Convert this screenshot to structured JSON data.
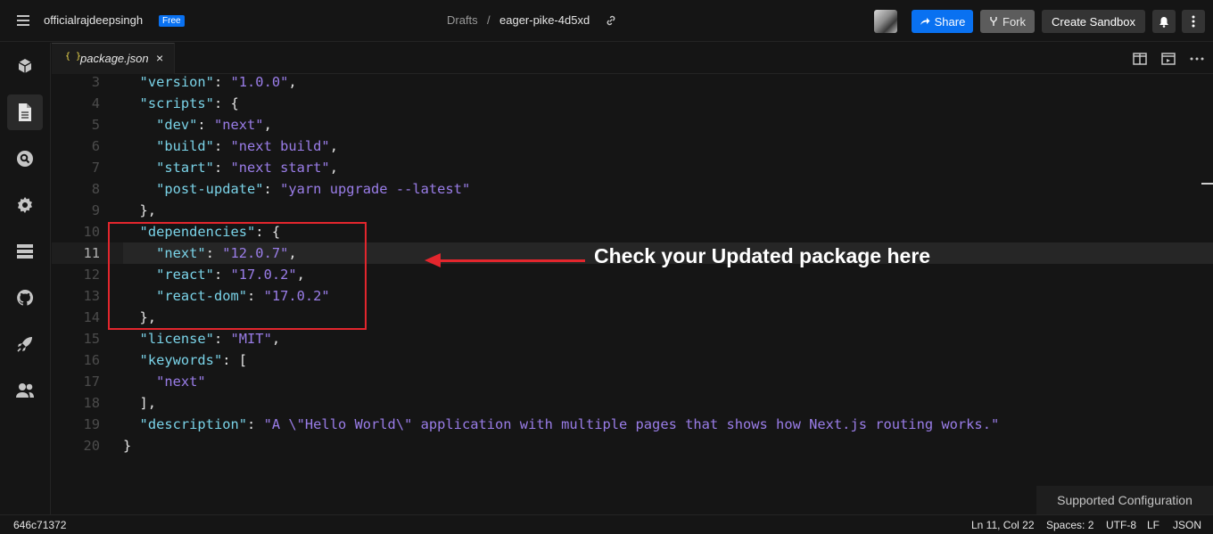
{
  "header": {
    "username": "officialrajdeepsingh",
    "plan_badge": "Free",
    "breadcrumb_drafts": "Drafts",
    "breadcrumb_sep": "/",
    "sandbox_name": "eager-pike-4d5xd",
    "share_label": "Share",
    "fork_label": "Fork",
    "create_label": "Create Sandbox"
  },
  "tab": {
    "icon_text": "{ }",
    "filename": "package.json",
    "close": "×"
  },
  "editor": {
    "lines": [
      {
        "n": "3"
      },
      {
        "n": "4"
      },
      {
        "n": "5"
      },
      {
        "n": "6"
      },
      {
        "n": "7"
      },
      {
        "n": "8"
      },
      {
        "n": "9"
      },
      {
        "n": "10"
      },
      {
        "n": "11"
      },
      {
        "n": "12"
      },
      {
        "n": "13"
      },
      {
        "n": "14"
      },
      {
        "n": "15"
      },
      {
        "n": "16"
      },
      {
        "n": "17"
      },
      {
        "n": "18"
      },
      {
        "n": "19"
      },
      {
        "n": "20"
      }
    ],
    "tokens": {
      "version_key": "\"version\"",
      "version_val": "\"1.0.0\"",
      "scripts_key": "\"scripts\"",
      "dev_key": "\"dev\"",
      "dev_val": "\"next\"",
      "build_key": "\"build\"",
      "build_val": "\"next build\"",
      "start_key": "\"start\"",
      "start_val": "\"next start\"",
      "post_key": "\"post-update\"",
      "post_val": "\"yarn upgrade --latest\"",
      "deps_key": "\"dependencies\"",
      "next_key": "\"next\"",
      "next_val": "\"12.0.7\"",
      "react_key": "\"react\"",
      "react_val": "\"17.0.2\"",
      "reactdom_key": "\"react-dom\"",
      "reactdom_val": "\"17.0.2\"",
      "license_key": "\"license\"",
      "license_val": "\"MIT\"",
      "keywords_key": "\"keywords\"",
      "kw_val": "\"next\"",
      "desc_key": "\"description\"",
      "desc_val": "\"A \\\"Hello World\\\" application with multiple pages that shows how Next.js routing works.\""
    }
  },
  "annotation": {
    "text": "Check your Updated package here",
    "color": "#e3262d"
  },
  "notification": {
    "text": "Supported Configuration"
  },
  "status": {
    "commit": "646c71372",
    "position": "Ln 11, Col 22",
    "spaces": "Spaces: 2",
    "encoding": "UTF-8",
    "eol": "LF",
    "language": "JSON"
  },
  "colors": {
    "accent": "#0971f1",
    "key": "#7ad3e8",
    "string": "#9a7de8"
  }
}
